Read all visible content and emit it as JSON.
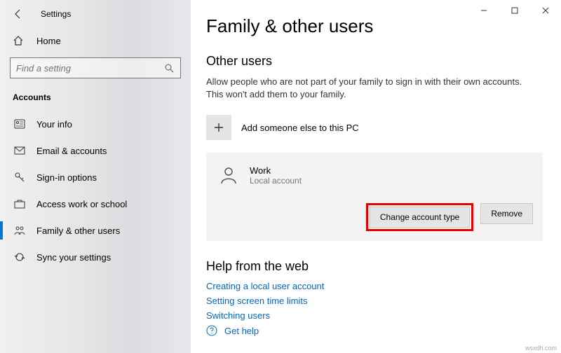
{
  "titlebar": {
    "title": "Settings"
  },
  "sidebar": {
    "home": "Home",
    "search_placeholder": "Find a setting",
    "section": "Accounts",
    "items": [
      {
        "label": "Your info"
      },
      {
        "label": "Email & accounts"
      },
      {
        "label": "Sign-in options"
      },
      {
        "label": "Access work or school"
      },
      {
        "label": "Family & other users"
      },
      {
        "label": "Sync your settings"
      }
    ]
  },
  "main": {
    "heading": "Family & other users",
    "other_users_heading": "Other users",
    "other_users_desc": "Allow people who are not part of your family to sign in with their own accounts. This won't add them to your family.",
    "add_label": "Add someone else to this PC",
    "user": {
      "name": "Work",
      "sub": "Local account",
      "change_btn": "Change account type",
      "remove_btn": "Remove"
    },
    "help_heading": "Help from the web",
    "help_links": [
      "Creating a local user account",
      "Setting screen time limits",
      "Switching users"
    ],
    "get_help": "Get help"
  },
  "watermark": "wsxdh.com"
}
